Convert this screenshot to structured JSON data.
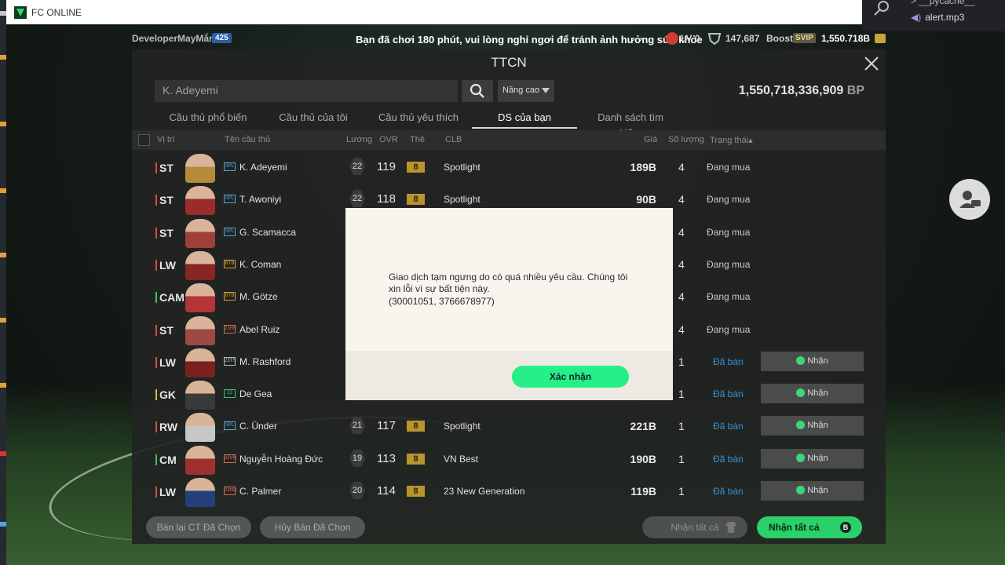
{
  "window": {
    "title": "FC ONLINE",
    "logo_icon": "fc-online-logo-icon"
  },
  "explorer": {
    "folder": "__pycache__",
    "file": "alert.mp3"
  },
  "status": {
    "username": "DeveloperMayMắn",
    "level_badge": "425",
    "warning": "Bạn đã chơi 180 phút, vui lòng nghỉ ngơi để tránh ảnh hưởng sức khỏe",
    "lv": "LV 0",
    "coins": "147,687",
    "boost": "Boost",
    "svip": "SVIP",
    "bp": "1,550.718B"
  },
  "panel": {
    "title": "TTCN",
    "search_value": "K. Adeyemi",
    "advanced_label": "Nâng cao",
    "bp_total": "1,550,718,336,909",
    "bp_unit": "BP"
  },
  "tabs": [
    {
      "label": "Cầu thủ phổ biến"
    },
    {
      "label": "Cầu thủ của tôi"
    },
    {
      "label": "Cầu thủ yêu thích"
    },
    {
      "label": "DS của bạn",
      "active": true
    },
    {
      "label": "Danh sách tìm kiếm"
    }
  ],
  "columns": {
    "position": "Vị trí",
    "name": "Tên cầu thủ",
    "wage": "Lương",
    "ovr": "OVR",
    "card": "Thẻ",
    "club": "CLB",
    "price": "Giá",
    "qty": "Số lượng",
    "status": "Trạng thái▴"
  },
  "rows": [
    {
      "pos": "ST",
      "pos_color": "#d94a4a",
      "season": "SPL",
      "season_color": "#5ca3d6",
      "name": "K. Adeyemi",
      "wage": "22",
      "ovr": "119",
      "grade": "8",
      "club": "Spotlight",
      "price": "189B",
      "qty": "4",
      "status": "Đang mua"
    },
    {
      "pos": "ST",
      "pos_color": "#d94a4a",
      "season": "SPL",
      "season_color": "#5ca3d6",
      "name": "T. Awoniyi",
      "wage": "22",
      "ovr": "118",
      "grade": "8",
      "club": "Spotlight",
      "price": "90B",
      "qty": "4",
      "status": "Đang mua"
    },
    {
      "pos": "ST",
      "pos_color": "#d94a4a",
      "season": "SPL",
      "season_color": "#5ca3d6",
      "name": "G. Scamacca",
      "wage": "",
      "ovr": "",
      "grade": "",
      "club": "",
      "price": "",
      "qty": "4",
      "status": "Đang mua"
    },
    {
      "pos": "LW",
      "pos_color": "#d94a4a",
      "season": "BTB",
      "season_color": "#d4a13a",
      "name": "K. Coman",
      "wage": "",
      "ovr": "",
      "grade": "",
      "club": "",
      "price": "",
      "qty": "4",
      "status": "Đang mua"
    },
    {
      "pos": "CAM",
      "pos_color": "#3fbf6a",
      "season": "BTB",
      "season_color": "#d4a13a",
      "name": "M. Götze",
      "wage": "",
      "ovr": "",
      "grade": "",
      "club": "",
      "price": "",
      "qty": "4",
      "status": "Đang mua"
    },
    {
      "pos": "ST",
      "pos_color": "#d94a4a",
      "season": "22HR",
      "season_color": "#d16b5a",
      "name": "Abel Ruiz",
      "wage": "",
      "ovr": "",
      "grade": "",
      "club": "",
      "price": "",
      "qty": "4",
      "status": "Đang mua"
    },
    {
      "pos": "LW",
      "pos_color": "#d94a4a",
      "season": "23TS",
      "season_color": "#b8bcc0",
      "name": "M. Rashford",
      "wage": "",
      "ovr": "",
      "grade": "",
      "club": "",
      "price": "",
      "qty": "1",
      "status": "Đã bán",
      "claim": "Nhận"
    },
    {
      "pos": "GK",
      "pos_color": "#e2b83c",
      "season": "22",
      "season_color": "#3fbf6a",
      "name": "De Gea",
      "wage": "",
      "ovr": "",
      "grade": "",
      "club": "",
      "price": "",
      "qty": "1",
      "status": "Đã bán",
      "claim": "Nhận"
    },
    {
      "pos": "RW",
      "pos_color": "#d94a4a",
      "season": "SPL",
      "season_color": "#5ca3d6",
      "name": "C. Ünder",
      "wage": "21",
      "ovr": "117",
      "grade": "8",
      "club": "Spotlight",
      "price": "221B",
      "qty": "1",
      "status": "Đã bán",
      "claim": "Nhận"
    },
    {
      "pos": "CM",
      "pos_color": "#3fbf6a",
      "season": "22VN",
      "season_color": "#d16b5a",
      "name": "Nguyễn Hoàng Đức",
      "wage": "19",
      "ovr": "113",
      "grade": "8",
      "club": "VN Best",
      "price": "190B",
      "qty": "1",
      "status": "Đã bán",
      "claim": "Nhận"
    },
    {
      "pos": "LW",
      "pos_color": "#d94a4a",
      "season": "23NG",
      "season_color": "#d16b5a",
      "name": "C. Palmer",
      "wage": "20",
      "ovr": "114",
      "grade": "8",
      "club": "23 New Generation",
      "price": "119B",
      "qty": "1",
      "status": "Đã bán",
      "claim": "Nhận"
    }
  ],
  "bottom": {
    "resell": "Bán lại CT Đã Chọn",
    "cancel": "Hủy Bán Đã Chọn",
    "claim_all_dim": "Nhận tất cả",
    "claim_all": "Nhận tất cả"
  },
  "modal": {
    "message": "Giao dịch tạm ngưng do có quá nhiều yêu cầu. Chúng tôi xin lỗi vì sự bất tiện này.",
    "code": "(30001051, 3766678977)",
    "confirm": "Xác nhận"
  },
  "colors": {
    "accent_green": "#25ef86",
    "sold_blue": "#3c8fd6",
    "grade_gold": "#b9932c"
  }
}
